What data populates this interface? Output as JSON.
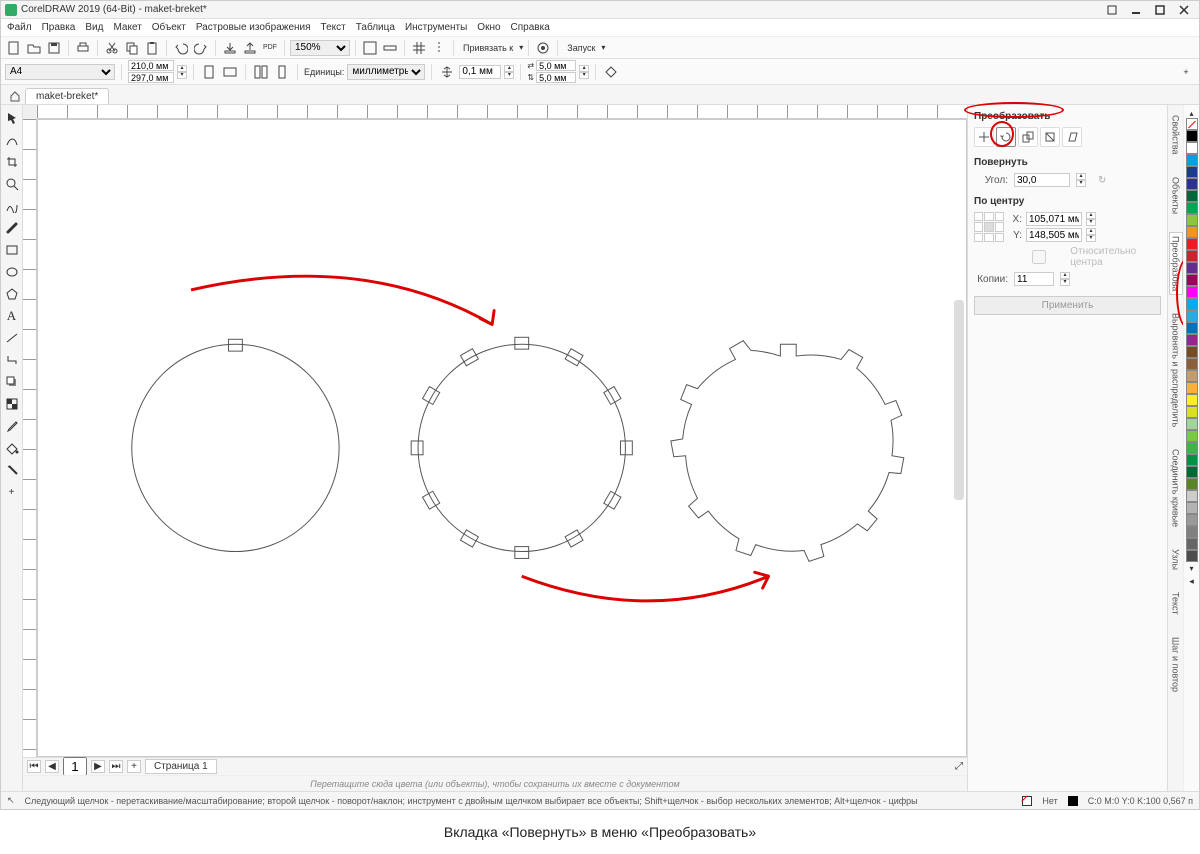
{
  "title": "CorelDRAW 2019 (64-Bit) - maket-breket*",
  "menubar": [
    "Файл",
    "Правка",
    "Вид",
    "Макет",
    "Объект",
    "Растровые изображения",
    "Текст",
    "Таблица",
    "Инструменты",
    "Окно",
    "Справка"
  ],
  "toolbar": {
    "zoom": "150%",
    "snap": "Привязать к",
    "launch": "Запуск"
  },
  "propbar": {
    "pageSize": "A4",
    "width": "210,0 мм",
    "height": "297,0 мм",
    "unitsLabel": "Единицы:",
    "units": "миллиметры",
    "nudge": "0,1 мм",
    "dup_x": "5,0 мм",
    "dup_y": "5,0 мм"
  },
  "docTab": "maket-breket*",
  "pageNav": {
    "page": "1",
    "tab": "Страница 1",
    "hint": "Перетащите сюда цвета (или объекты), чтобы сохранить их вместе с документом"
  },
  "dock": {
    "title": "Преобразовать",
    "section1": "Повернуть",
    "angleLabel": "Угол:",
    "angle": "30,0",
    "section2": "По центру",
    "xLabel": "X:",
    "x": "105,071 мм",
    "yLabel": "Y:",
    "y": "148,505 мм",
    "relCenter": "Относительно центра",
    "copiesLabel": "Копии:",
    "copies": "11",
    "apply": "Применить"
  },
  "vtabs": [
    "Свойства",
    "Объекты",
    "Преобразова",
    "Выровнять и распределить",
    "Соединить кривые",
    "Узлы",
    "Текст",
    "Шаг и повтор"
  ],
  "palette": [
    "#000000",
    "#ffffff",
    "#00a0e3",
    "#1a3e8c",
    "#2e3192",
    "#006838",
    "#00a651",
    "#8cc63f",
    "#f7931e",
    "#ed1c24",
    "#c1272d",
    "#662d91",
    "#9e005d",
    "#ff00ff",
    "#00aeef",
    "#29abe2",
    "#0071bc",
    "#93278f",
    "#754c24",
    "#8b5e3c",
    "#c69c6d",
    "#fbb03b",
    "#fcee21",
    "#d9e021",
    "#a3d39c",
    "#7ac943",
    "#39b54a",
    "#009245",
    "#006837",
    "#598527",
    "#cccccc",
    "#b3b3b3",
    "#999999",
    "#808080",
    "#666666",
    "#4d4d4d"
  ],
  "status": {
    "hint": "Следующий щелчок - перетаскивание/масштабирование; второй щелчок - поворот/наклон; инструмент с двойным щелчком выбирает все объекты; Shift+щелчок - выбор нескольких элементов; Alt+щелчок - цифры",
    "fill": "Нет",
    "outline": "C:0 M:0 Y:0 K:100  0,567 п"
  },
  "captionBelow": "Вкладка «Повернуть» в меню «Преобразовать»"
}
